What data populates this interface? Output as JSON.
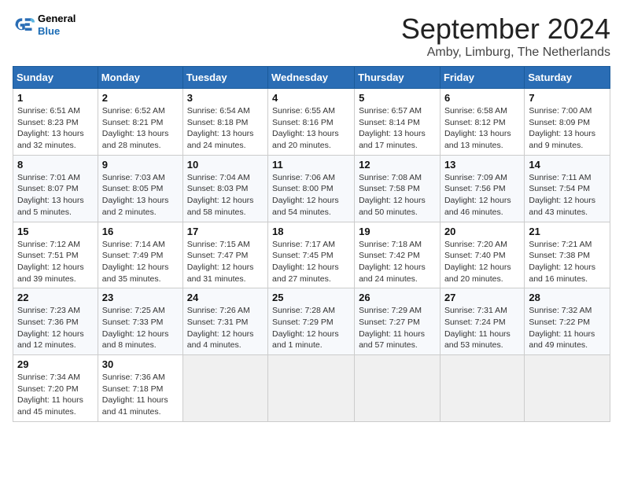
{
  "header": {
    "logo_general": "General",
    "logo_blue": "Blue",
    "month_title": "September 2024",
    "location": "Amby, Limburg, The Netherlands"
  },
  "weekdays": [
    "Sunday",
    "Monday",
    "Tuesday",
    "Wednesday",
    "Thursday",
    "Friday",
    "Saturday"
  ],
  "weeks": [
    [
      {
        "day": "1",
        "detail": "Sunrise: 6:51 AM\nSunset: 8:23 PM\nDaylight: 13 hours\nand 32 minutes."
      },
      {
        "day": "2",
        "detail": "Sunrise: 6:52 AM\nSunset: 8:21 PM\nDaylight: 13 hours\nand 28 minutes."
      },
      {
        "day": "3",
        "detail": "Sunrise: 6:54 AM\nSunset: 8:18 PM\nDaylight: 13 hours\nand 24 minutes."
      },
      {
        "day": "4",
        "detail": "Sunrise: 6:55 AM\nSunset: 8:16 PM\nDaylight: 13 hours\nand 20 minutes."
      },
      {
        "day": "5",
        "detail": "Sunrise: 6:57 AM\nSunset: 8:14 PM\nDaylight: 13 hours\nand 17 minutes."
      },
      {
        "day": "6",
        "detail": "Sunrise: 6:58 AM\nSunset: 8:12 PM\nDaylight: 13 hours\nand 13 minutes."
      },
      {
        "day": "7",
        "detail": "Sunrise: 7:00 AM\nSunset: 8:09 PM\nDaylight: 13 hours\nand 9 minutes."
      }
    ],
    [
      {
        "day": "8",
        "detail": "Sunrise: 7:01 AM\nSunset: 8:07 PM\nDaylight: 13 hours\nand 5 minutes."
      },
      {
        "day": "9",
        "detail": "Sunrise: 7:03 AM\nSunset: 8:05 PM\nDaylight: 13 hours\nand 2 minutes."
      },
      {
        "day": "10",
        "detail": "Sunrise: 7:04 AM\nSunset: 8:03 PM\nDaylight: 12 hours\nand 58 minutes."
      },
      {
        "day": "11",
        "detail": "Sunrise: 7:06 AM\nSunset: 8:00 PM\nDaylight: 12 hours\nand 54 minutes."
      },
      {
        "day": "12",
        "detail": "Sunrise: 7:08 AM\nSunset: 7:58 PM\nDaylight: 12 hours\nand 50 minutes."
      },
      {
        "day": "13",
        "detail": "Sunrise: 7:09 AM\nSunset: 7:56 PM\nDaylight: 12 hours\nand 46 minutes."
      },
      {
        "day": "14",
        "detail": "Sunrise: 7:11 AM\nSunset: 7:54 PM\nDaylight: 12 hours\nand 43 minutes."
      }
    ],
    [
      {
        "day": "15",
        "detail": "Sunrise: 7:12 AM\nSunset: 7:51 PM\nDaylight: 12 hours\nand 39 minutes."
      },
      {
        "day": "16",
        "detail": "Sunrise: 7:14 AM\nSunset: 7:49 PM\nDaylight: 12 hours\nand 35 minutes."
      },
      {
        "day": "17",
        "detail": "Sunrise: 7:15 AM\nSunset: 7:47 PM\nDaylight: 12 hours\nand 31 minutes."
      },
      {
        "day": "18",
        "detail": "Sunrise: 7:17 AM\nSunset: 7:45 PM\nDaylight: 12 hours\nand 27 minutes."
      },
      {
        "day": "19",
        "detail": "Sunrise: 7:18 AM\nSunset: 7:42 PM\nDaylight: 12 hours\nand 24 minutes."
      },
      {
        "day": "20",
        "detail": "Sunrise: 7:20 AM\nSunset: 7:40 PM\nDaylight: 12 hours\nand 20 minutes."
      },
      {
        "day": "21",
        "detail": "Sunrise: 7:21 AM\nSunset: 7:38 PM\nDaylight: 12 hours\nand 16 minutes."
      }
    ],
    [
      {
        "day": "22",
        "detail": "Sunrise: 7:23 AM\nSunset: 7:36 PM\nDaylight: 12 hours\nand 12 minutes."
      },
      {
        "day": "23",
        "detail": "Sunrise: 7:25 AM\nSunset: 7:33 PM\nDaylight: 12 hours\nand 8 minutes."
      },
      {
        "day": "24",
        "detail": "Sunrise: 7:26 AM\nSunset: 7:31 PM\nDaylight: 12 hours\nand 4 minutes."
      },
      {
        "day": "25",
        "detail": "Sunrise: 7:28 AM\nSunset: 7:29 PM\nDaylight: 12 hours\nand 1 minute."
      },
      {
        "day": "26",
        "detail": "Sunrise: 7:29 AM\nSunset: 7:27 PM\nDaylight: 11 hours\nand 57 minutes."
      },
      {
        "day": "27",
        "detail": "Sunrise: 7:31 AM\nSunset: 7:24 PM\nDaylight: 11 hours\nand 53 minutes."
      },
      {
        "day": "28",
        "detail": "Sunrise: 7:32 AM\nSunset: 7:22 PM\nDaylight: 11 hours\nand 49 minutes."
      }
    ],
    [
      {
        "day": "29",
        "detail": "Sunrise: 7:34 AM\nSunset: 7:20 PM\nDaylight: 11 hours\nand 45 minutes."
      },
      {
        "day": "30",
        "detail": "Sunrise: 7:36 AM\nSunset: 7:18 PM\nDaylight: 11 hours\nand 41 minutes."
      },
      {
        "day": "",
        "detail": ""
      },
      {
        "day": "",
        "detail": ""
      },
      {
        "day": "",
        "detail": ""
      },
      {
        "day": "",
        "detail": ""
      },
      {
        "day": "",
        "detail": ""
      }
    ]
  ]
}
